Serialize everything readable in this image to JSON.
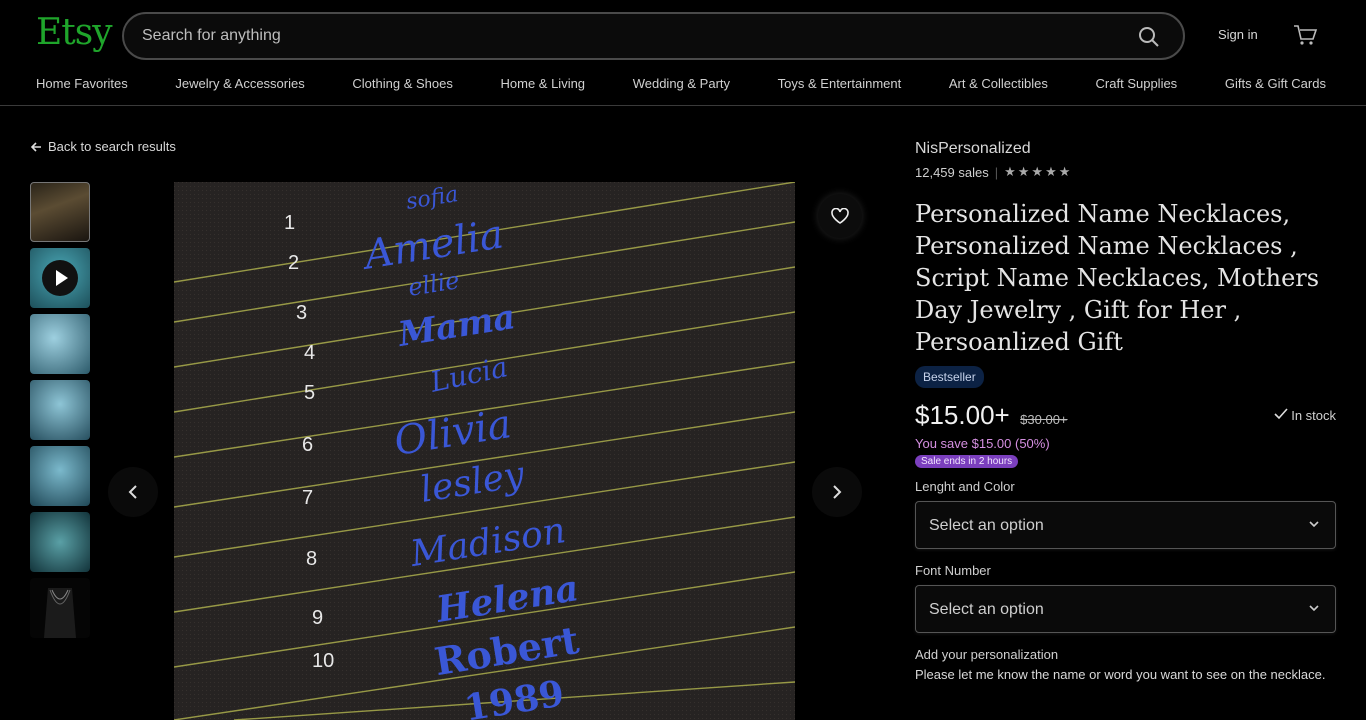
{
  "header": {
    "logo": "Etsy",
    "search_placeholder": "Search for anything",
    "sign_in": "Sign in"
  },
  "nav": [
    "Home Favorites",
    "Jewelry & Accessories",
    "Clothing & Shoes",
    "Home & Living",
    "Wedding & Party",
    "Toys & Entertainment",
    "Art & Collectibles",
    "Craft Supplies",
    "Gifts & Gift Cards"
  ],
  "back_link": "Back to search results",
  "gallery": {
    "numbers": [
      "1",
      "2",
      "3",
      "4",
      "5",
      "6",
      "7",
      "8",
      "9",
      "10"
    ],
    "names": [
      "sofia",
      "Amelia",
      "ellie",
      "Mama",
      "Lucia",
      "Olivia",
      "lesley",
      "Madison",
      "Helena",
      "Robert",
      "1989"
    ]
  },
  "listing": {
    "shop_name": "NisPersonalized",
    "sales": "12,459 sales",
    "stars": "★★★★★",
    "title": "Personalized Name Necklaces, Personalized Name Necklaces , Script Name Necklaces, Mothers Day Jewelry , Gift for Her , Persoanlized Gift",
    "badge": "Bestseller",
    "price": "$15.00+",
    "original_price": "$30.00+",
    "stock": "In stock",
    "savings": "You save $15.00 (50%)",
    "sale_ends": "Sale ends in 2 hours",
    "option1_label": "Lenght and Color",
    "option1_value": "Select an option",
    "option2_label": "Font Number",
    "option2_value": "Select an option",
    "personalization_title": "Add your personalization",
    "personalization_desc": "Please let me know the name or word you want to see on the necklace."
  },
  "colors": {
    "brand": "#1fa52b",
    "badge_bg": "#0c2244",
    "sale_purple": "#7b3fbe"
  }
}
